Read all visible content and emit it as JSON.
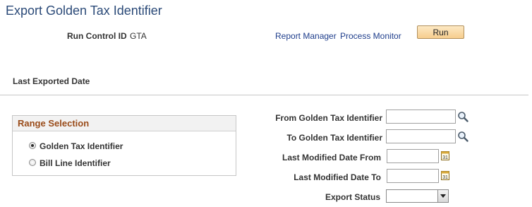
{
  "page": {
    "title": "Export Golden Tax Identifier"
  },
  "run_control": {
    "label": "Run Control ID",
    "value": "GTA"
  },
  "links": {
    "report_manager": "Report Manager",
    "process_monitor": "Process Monitor"
  },
  "toolbar": {
    "run_label": "Run"
  },
  "last_exported": {
    "label": "Last Exported Date"
  },
  "range_selection": {
    "title": "Range Selection",
    "options": [
      {
        "label": "Golden Tax Identifier",
        "selected": true
      },
      {
        "label": "Bill Line Identifier",
        "selected": false
      }
    ]
  },
  "fields": {
    "from_gti_label": "From Golden Tax Identifier",
    "to_gti_label": "To Golden Tax Identifier",
    "date_from_label": "Last Modified Date From",
    "date_to_label": "Last Modified Date To",
    "export_status_label": "Export Status",
    "from_gti_value": "",
    "to_gti_value": "",
    "date_from_value": "",
    "date_to_value": "",
    "export_status_value": ""
  },
  "icons": {
    "lookup": "magnifier-icon",
    "calendar": "calendar-icon",
    "dropdown": "chevron-down-icon"
  },
  "colors": {
    "title": "#2b4a78",
    "link": "#1f3e8c",
    "group_title": "#9a4c1a",
    "run_button": "#f6cd8d"
  }
}
